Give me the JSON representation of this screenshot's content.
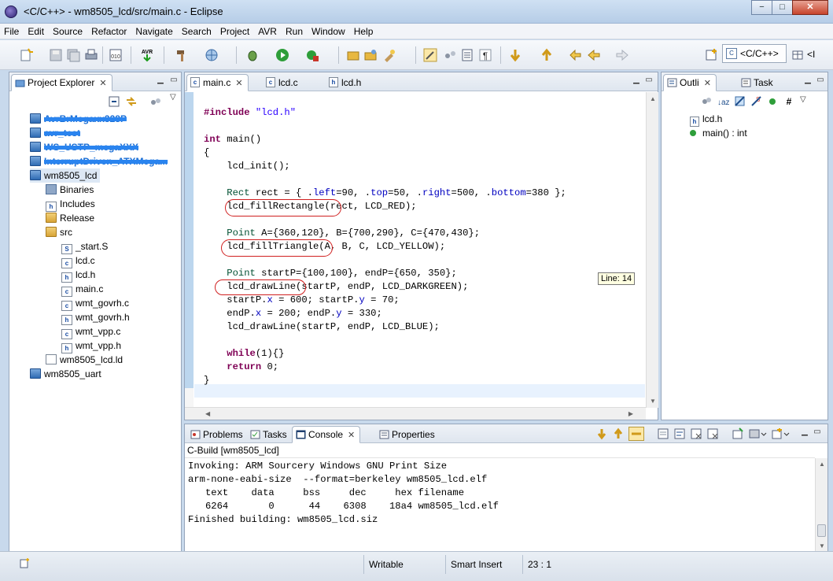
{
  "window": {
    "title": "<C/C++> - wm8505_lcd/src/main.c - Eclipse",
    "minimize": "−",
    "maximize": "□",
    "close": "✕"
  },
  "menu": [
    "File",
    "Edit",
    "Source",
    "Refactor",
    "Navigate",
    "Search",
    "Project",
    "AVR",
    "Run",
    "Window",
    "Help"
  ],
  "perspective": {
    "label": "<C/C++>",
    "icon_text": "C",
    "overflow": "<I"
  },
  "project_explorer": {
    "tab": "Project Explorer",
    "close": "✕",
    "projects_scribbled": [
      "AvrBrMegaxx328P",
      "avr_test",
      "WS_USTP_megaXXX",
      "InterruptDriven_ATXMega..."
    ],
    "project": "wm8505_lcd",
    "children": [
      "Binaries",
      "Includes",
      "Release",
      "src"
    ],
    "src_files": [
      {
        "name": "_start.S",
        "icon": "S"
      },
      {
        "name": "lcd.c",
        "icon": "c"
      },
      {
        "name": "lcd.h",
        "icon": "h"
      },
      {
        "name": "main.c",
        "icon": "c"
      },
      {
        "name": "wmt_govrh.c",
        "icon": "c"
      },
      {
        "name": "wmt_govrh.h",
        "icon": "h"
      },
      {
        "name": "wmt_vpp.c",
        "icon": "c"
      },
      {
        "name": "wmt_vpp.h",
        "icon": "h"
      }
    ],
    "ld_file": "wm8505_lcd.ld",
    "other_project": "wm8505_uart"
  },
  "editor": {
    "tabs": [
      {
        "label": "main.c",
        "icon": "c",
        "close": "✕"
      },
      {
        "label": "lcd.c",
        "icon": "c"
      },
      {
        "label": "lcd.h",
        "icon": "h"
      }
    ],
    "code": {
      "include_kw": "#include",
      "include_str": "\"lcd.h\"",
      "int_kw": "int",
      "main_sig": " main()",
      "open_brace": "{",
      "init": "    lcd_init();",
      "rect_type": "    Rect",
      "rect_pre": " rect = { .",
      "left_fld": "left",
      "rect_mid1": "=90, .",
      "top_fld": "top",
      "rect_mid2": "=50, .",
      "right_fld": "right",
      "rect_mid3": "=500, .",
      "bottom_fld": "bottom",
      "rect_end": "=380 };",
      "fill_rect": "    lcd_fillRectangle(rect, LCD_RED);",
      "point_type": "    Point",
      "point_line": " A={360,120}, B={700,290}, C={470,430};",
      "fill_tri": "    lcd_fillTriangle(A, B, C, LCD_YELLOW);",
      "point2_type": "    Point",
      "point2_line": " startP={100,100}, endP={650, 350};",
      "draw_line1": "    lcd_drawLine(startP, endP, LCD_DARKGREEN);",
      "sx_pre": "    startP.",
      "x_fld": "x",
      "sx_mid": " = 600; startP.",
      "y_fld": "y",
      "sx_end": " = 70;",
      "ex_pre": "    endP.",
      "ex_mid": " = 200; endP.",
      "ex_end": " = 330;",
      "draw_line2": "    lcd_drawLine(startP, endP, LCD_BLUE);",
      "while_kw": "    while",
      "while_rest": "(1){}",
      "return_kw": "    return",
      "return_rest": " 0;",
      "close_brace": "}"
    },
    "tooltip": "Line: 14"
  },
  "outline": {
    "tabs": [
      {
        "label": "Outli",
        "close": "✕"
      },
      {
        "label": "Task"
      }
    ],
    "items": [
      {
        "label": "lcd.h"
      },
      {
        "label": "main() : int"
      }
    ]
  },
  "console": {
    "tabs": [
      {
        "label": "Problems"
      },
      {
        "label": "Tasks"
      },
      {
        "label": "Console",
        "close": "✕"
      },
      {
        "label": "Properties"
      }
    ],
    "header": "C-Build [wm8505_lcd]",
    "lines": [
      "Invoking: ARM Sourcery Windows GNU Print Size",
      "arm-none-eabi-size  --format=berkeley wm8505_lcd.elf",
      "   text    data     bss     dec     hex filename",
      "   6264       0      44    6308    18a4 wm8505_lcd.elf",
      "Finished building: wm8505_lcd.siz"
    ]
  },
  "status": {
    "writable": "Writable",
    "insert": "Smart Insert",
    "position": "23 : 1"
  },
  "colors": {
    "keyword": "#7f0055",
    "string": "#2a00ff",
    "field": "#0000c0",
    "annotation_oval": "#d02020",
    "selection": "#bcd6ee"
  }
}
